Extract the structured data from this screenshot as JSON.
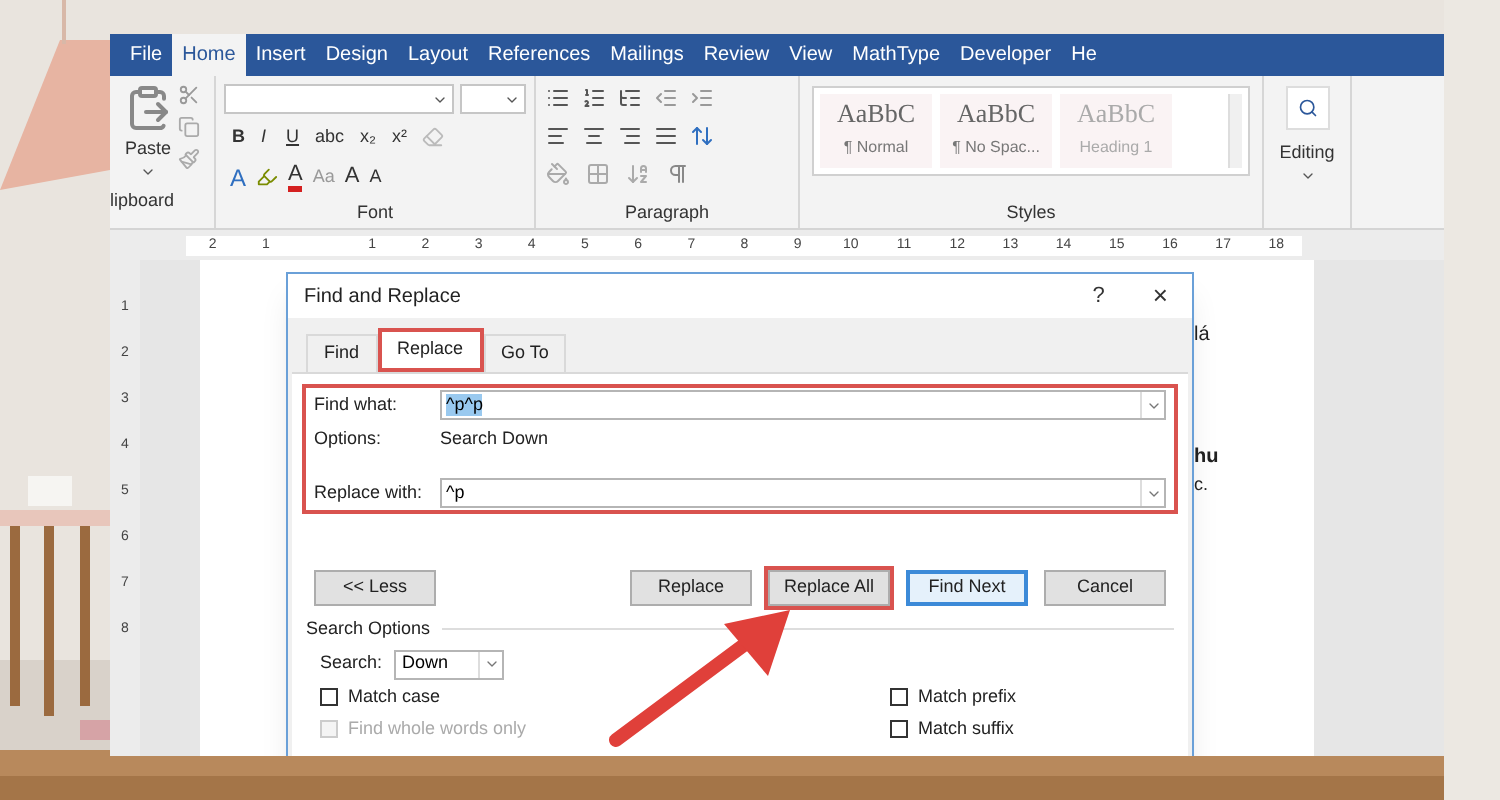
{
  "ribbon_tabs": [
    {
      "label": "File",
      "selected": false
    },
    {
      "label": "Home",
      "selected": true
    },
    {
      "label": "Insert",
      "selected": false
    },
    {
      "label": "Design",
      "selected": false
    },
    {
      "label": "Layout",
      "selected": false
    },
    {
      "label": "References",
      "selected": false
    },
    {
      "label": "Mailings",
      "selected": false
    },
    {
      "label": "Review",
      "selected": false
    },
    {
      "label": "View",
      "selected": false
    },
    {
      "label": "MathType",
      "selected": false
    },
    {
      "label": "Developer",
      "selected": false
    },
    {
      "label": "He",
      "selected": false
    }
  ],
  "clipboard": {
    "paste": "Paste",
    "group": "lipboard"
  },
  "font": {
    "group": "Font",
    "format_buttons": [
      "B",
      "I",
      "U",
      "abc",
      "x₂",
      "x²"
    ],
    "text_effects": "A",
    "font_color": "A",
    "change_case": "Aa",
    "grow": "A",
    "shrink": "A"
  },
  "paragraph": {
    "group": "Paragraph"
  },
  "styles": {
    "group": "Styles",
    "items": [
      {
        "preview": "AaBbC",
        "name": "¶ Normal",
        "dimmed": false
      },
      {
        "preview": "AaBbC",
        "name": "¶ No Spac...",
        "dimmed": false
      },
      {
        "preview": "AaBbC",
        "name": "Heading 1",
        "dimmed": true
      }
    ]
  },
  "editing": {
    "label": "Editing"
  },
  "ruler": {
    "left_numbers": [
      "2",
      "1"
    ],
    "numbers": [
      "1",
      "2",
      "3",
      "4",
      "5",
      "6",
      "7",
      "8",
      "9",
      "10",
      "11",
      "12",
      "13",
      "14",
      "15",
      "16",
      "17",
      "18"
    ]
  },
  "vertical_ruler": {
    "numbers": [
      "1",
      "2",
      "3",
      "4",
      "5",
      "6",
      "7",
      "8"
    ]
  },
  "document": {
    "fragments": [
      "lá",
      "hu",
      "c."
    ]
  },
  "dialog": {
    "title": "Find and Replace",
    "help": "?",
    "close": "×",
    "tabs": [
      {
        "label": "Find",
        "selected": false,
        "highlighted": false
      },
      {
        "label": "Replace",
        "selected": true,
        "highlighted": true
      },
      {
        "label": "Go To",
        "selected": false,
        "highlighted": false
      }
    ],
    "fields_highlighted": true,
    "find_what": {
      "label": "Find what:",
      "value": "^p^p",
      "text_selected": true
    },
    "options": {
      "label": "Options:",
      "value": "Search Down"
    },
    "replace_with": {
      "label": "Replace with:",
      "value": "^p"
    },
    "buttons": [
      {
        "label": "<< Less",
        "kind": "less",
        "highlighted": false,
        "default": false
      },
      {
        "label": "Replace",
        "kind": "action",
        "highlighted": false,
        "default": false
      },
      {
        "label": "Replace All",
        "kind": "action",
        "highlighted": true,
        "default": false
      },
      {
        "label": "Find Next",
        "kind": "action",
        "highlighted": false,
        "default": true
      },
      {
        "label": "Cancel",
        "kind": "action",
        "highlighted": false,
        "default": false
      }
    ],
    "search_options": {
      "title": "Search Options",
      "search_label": "Search:",
      "search_value": "Down"
    },
    "checkboxes_left": [
      {
        "label": "Match case",
        "checked": false,
        "disabled": false
      },
      {
        "label": "Find whole words only",
        "checked": false,
        "disabled": true
      }
    ],
    "checkboxes_right": [
      {
        "label": "Match prefix",
        "checked": false,
        "disabled": false
      },
      {
        "label": "Match suffix",
        "checked": false,
        "disabled": false
      }
    ]
  }
}
